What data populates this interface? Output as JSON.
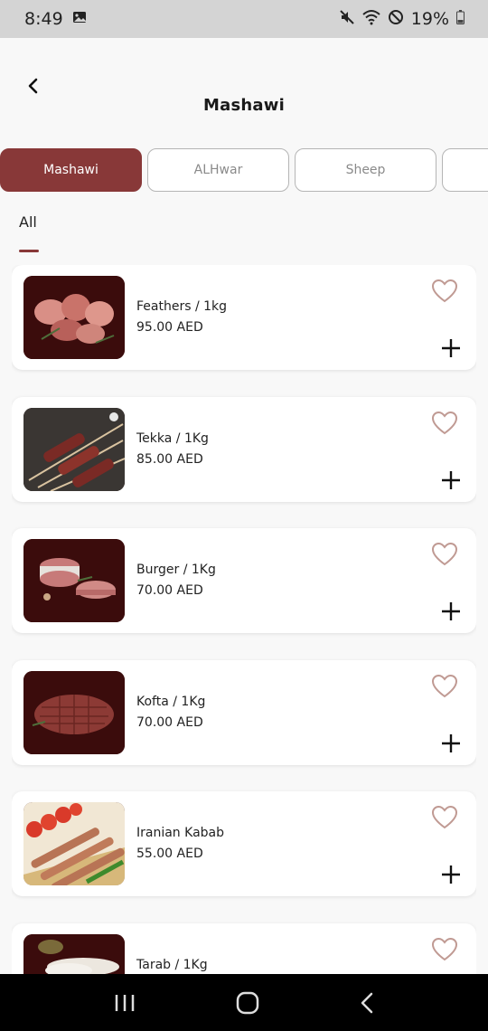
{
  "status": {
    "time": "8:49",
    "battery": "19%"
  },
  "header": {
    "title": "Mashawi"
  },
  "tabs": [
    {
      "label": "Mashawi"
    },
    {
      "label": "ALHwar"
    },
    {
      "label": "Sheep"
    },
    {
      "label": ""
    }
  ],
  "subtab": {
    "label": "All"
  },
  "products": [
    {
      "name": "Feathers / 1kg",
      "price": "95.00 AED"
    },
    {
      "name": "Tekka / 1Kg",
      "price": "85.00 AED"
    },
    {
      "name": "Burger / 1Kg",
      "price": "70.00 AED"
    },
    {
      "name": "Kofta / 1Kg",
      "price": "70.00 AED"
    },
    {
      "name": "Iranian Kabab",
      "price": "55.00 AED"
    },
    {
      "name": "Tarab / 1Kg",
      "price": ""
    }
  ],
  "colors": {
    "accent": "#883838",
    "heart": "#c09a93"
  }
}
